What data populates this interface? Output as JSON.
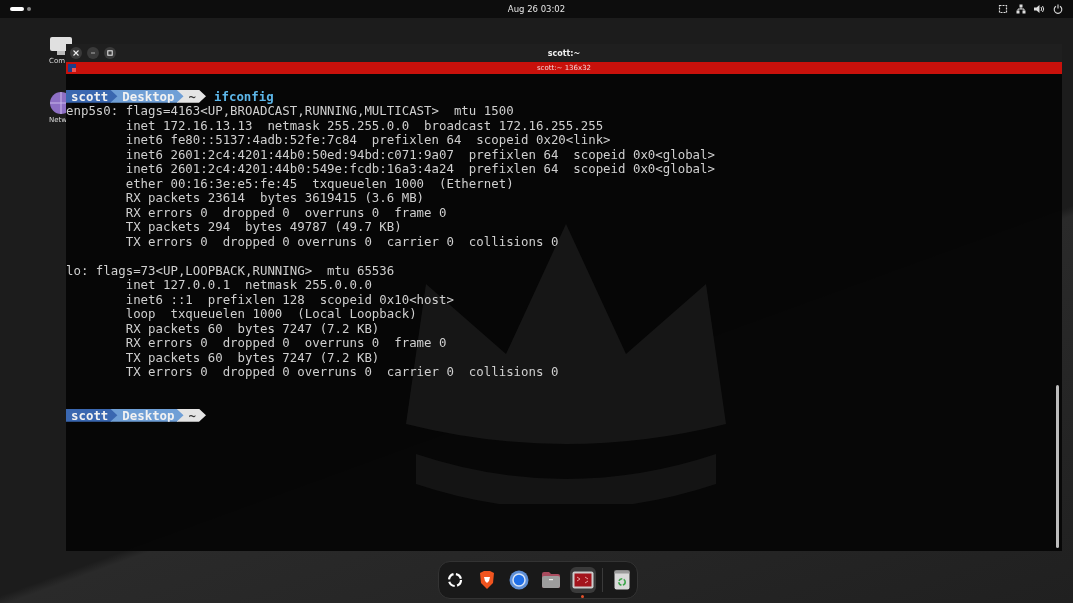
{
  "top_bar": {
    "clock": "Aug 26  03:02"
  },
  "desktop_icons": [
    {
      "label": "Com",
      "kind": "computer"
    },
    {
      "label": "Netw",
      "kind": "network"
    }
  ],
  "terminal": {
    "title": "scott:~",
    "tab_title": "scott:~ 136x32",
    "lines": [
      {
        "kind": "prompt",
        "segments": [
          {
            "text": "scott",
            "color": "#3a67b0"
          },
          {
            "text": "Desktop",
            "color": "#6f9fd6"
          },
          {
            "text": "~",
            "color": "#e4e4e4"
          }
        ],
        "command": "ifconfig"
      },
      {
        "kind": "text",
        "text": "enp5s0: flags=4163<UP,BROADCAST,RUNNING,MULTICAST>  mtu 1500"
      },
      {
        "kind": "text",
        "text": "        inet 172.16.13.13  netmask 255.255.0.0  broadcast 172.16.255.255"
      },
      {
        "kind": "text",
        "text": "        inet6 fe80::5137:4adb:52fe:7c84  prefixlen 64  scopeid 0x20<link>"
      },
      {
        "kind": "text",
        "text": "        inet6 2601:2c4:4201:44b0:50ed:94bd:c071:9a07  prefixlen 64  scopeid 0x0<global>"
      },
      {
        "kind": "text",
        "text": "        inet6 2601:2c4:4201:44b0:549e:fcdb:16a3:4a24  prefixlen 64  scopeid 0x0<global>"
      },
      {
        "kind": "text",
        "text": "        ether 00:16:3e:e5:fe:45  txqueuelen 1000  (Ethernet)"
      },
      {
        "kind": "text",
        "text": "        RX packets 23614  bytes 3619415 (3.6 MB)"
      },
      {
        "kind": "text",
        "text": "        RX errors 0  dropped 0  overruns 0  frame 0"
      },
      {
        "kind": "text",
        "text": "        TX packets 294  bytes 49787 (49.7 KB)"
      },
      {
        "kind": "text",
        "text": "        TX errors 0  dropped 0 overruns 0  carrier 0  collisions 0"
      },
      {
        "kind": "blank"
      },
      {
        "kind": "text",
        "text": "lo: flags=73<UP,LOOPBACK,RUNNING>  mtu 65536"
      },
      {
        "kind": "text",
        "text": "        inet 127.0.0.1  netmask 255.0.0.0"
      },
      {
        "kind": "text",
        "text": "        inet6 ::1  prefixlen 128  scopeid 0x10<host>"
      },
      {
        "kind": "text",
        "text": "        loop  txqueuelen 1000  (Local Loopback)"
      },
      {
        "kind": "text",
        "text": "        RX packets 60  bytes 7247 (7.2 KB)"
      },
      {
        "kind": "text",
        "text": "        RX errors 0  dropped 0  overruns 0  frame 0"
      },
      {
        "kind": "text",
        "text": "        TX packets 60  bytes 7247 (7.2 KB)"
      },
      {
        "kind": "text",
        "text": "        TX errors 0  dropped 0 overruns 0  carrier 0  collisions 0"
      },
      {
        "kind": "blank"
      },
      {
        "kind": "blank"
      },
      {
        "kind": "prompt",
        "segments": [
          {
            "text": "scott",
            "color": "#3a67b0"
          },
          {
            "text": "Desktop",
            "color": "#6f9fd6"
          },
          {
            "text": "~",
            "color": "#e4e4e4"
          }
        ]
      }
    ]
  },
  "dock": {
    "apps": [
      {
        "kind": "launcher",
        "running": false
      },
      {
        "kind": "browser-lion",
        "running": false
      },
      {
        "kind": "browser-ring",
        "running": false
      },
      {
        "kind": "folder",
        "running": false
      },
      {
        "kind": "terminal",
        "running": true
      },
      {
        "kind": "separator"
      },
      {
        "kind": "trash",
        "running": false
      }
    ]
  }
}
